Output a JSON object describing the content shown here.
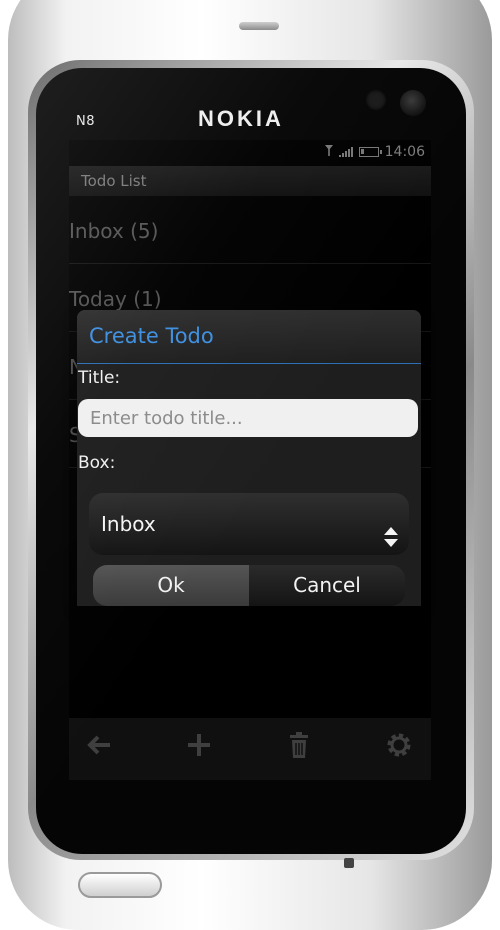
{
  "device": {
    "model": "N8",
    "brand": "NOKIA"
  },
  "status_bar": {
    "time": "14:06",
    "signal_icon": "antenna-icon",
    "battery_icon": "battery-icon"
  },
  "app": {
    "title": "Todo List",
    "list_items": [
      {
        "label": "Inbox (5)"
      },
      {
        "label": "Today (1)"
      },
      {
        "label": "N"
      },
      {
        "label": "S"
      }
    ]
  },
  "toolbar": {
    "items": [
      {
        "name": "back-icon",
        "glyph": "←"
      },
      {
        "name": "add-icon",
        "glyph": "+"
      },
      {
        "name": "trash-icon",
        "glyph": ""
      },
      {
        "name": "gear-icon",
        "glyph": ""
      }
    ]
  },
  "dialog": {
    "title": "Create Todo",
    "title_label": "Title:",
    "title_placeholder": "Enter todo title...",
    "title_value": "",
    "box_label": "Box:",
    "box_selected": "Inbox",
    "ok_label": "Ok",
    "cancel_label": "Cancel",
    "accent_color": "#3d8fe0"
  }
}
